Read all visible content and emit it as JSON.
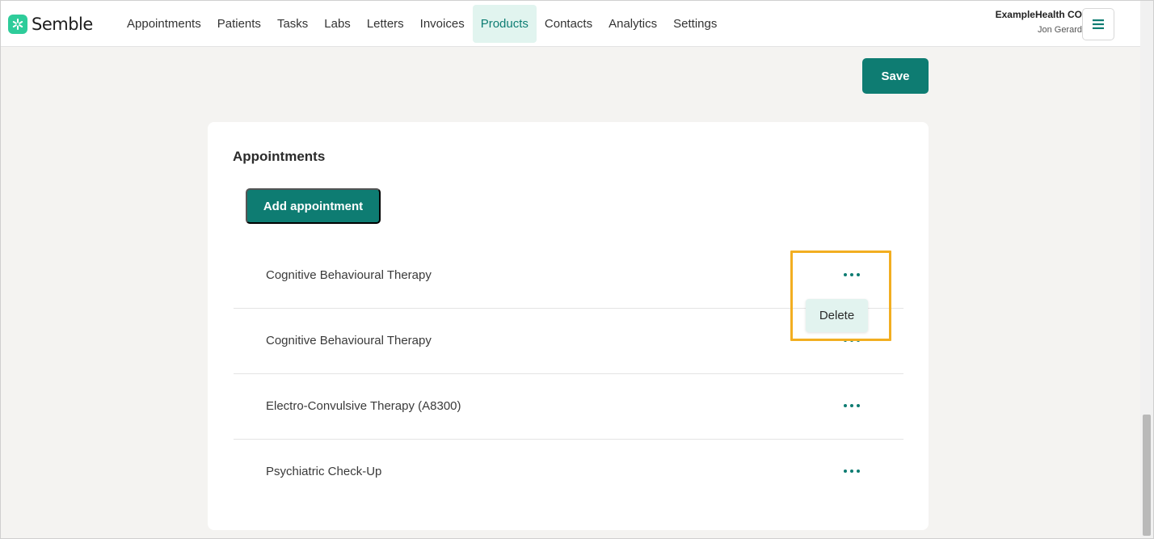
{
  "app": {
    "name": "Semble",
    "brand_color": "#0e7c72",
    "logo_color": "#2ecc9a"
  },
  "nav": {
    "items": [
      {
        "label": "Appointments",
        "active": false
      },
      {
        "label": "Patients",
        "active": false
      },
      {
        "label": "Tasks",
        "active": false
      },
      {
        "label": "Labs",
        "active": false
      },
      {
        "label": "Letters",
        "active": false
      },
      {
        "label": "Invoices",
        "active": false
      },
      {
        "label": "Products",
        "active": true
      },
      {
        "label": "Contacts",
        "active": false
      },
      {
        "label": "Analytics",
        "active": false
      },
      {
        "label": "Settings",
        "active": false
      }
    ]
  },
  "account": {
    "org": "ExampleHealth CO",
    "user": "Jon Gerard",
    "menu_icon": "hamburger-menu-icon"
  },
  "toolbar": {
    "save_label": "Save"
  },
  "appointments": {
    "title": "Appointments",
    "add_label": "Add appointment",
    "rows": [
      {
        "label": "Cognitive Behavioural Therapy",
        "more_icon": "more-horizontal-icon"
      },
      {
        "label": "Cognitive Behavioural Therapy",
        "more_icon": "more-horizontal-icon"
      },
      {
        "label": "Electro-Convulsive Therapy (A8300)",
        "more_icon": "more-horizontal-icon"
      },
      {
        "label": "Psychiatric Check-Up",
        "more_icon": "more-horizontal-icon"
      }
    ]
  },
  "dropdown": {
    "delete_label": "Delete"
  },
  "highlight_color": "#f2ae21"
}
